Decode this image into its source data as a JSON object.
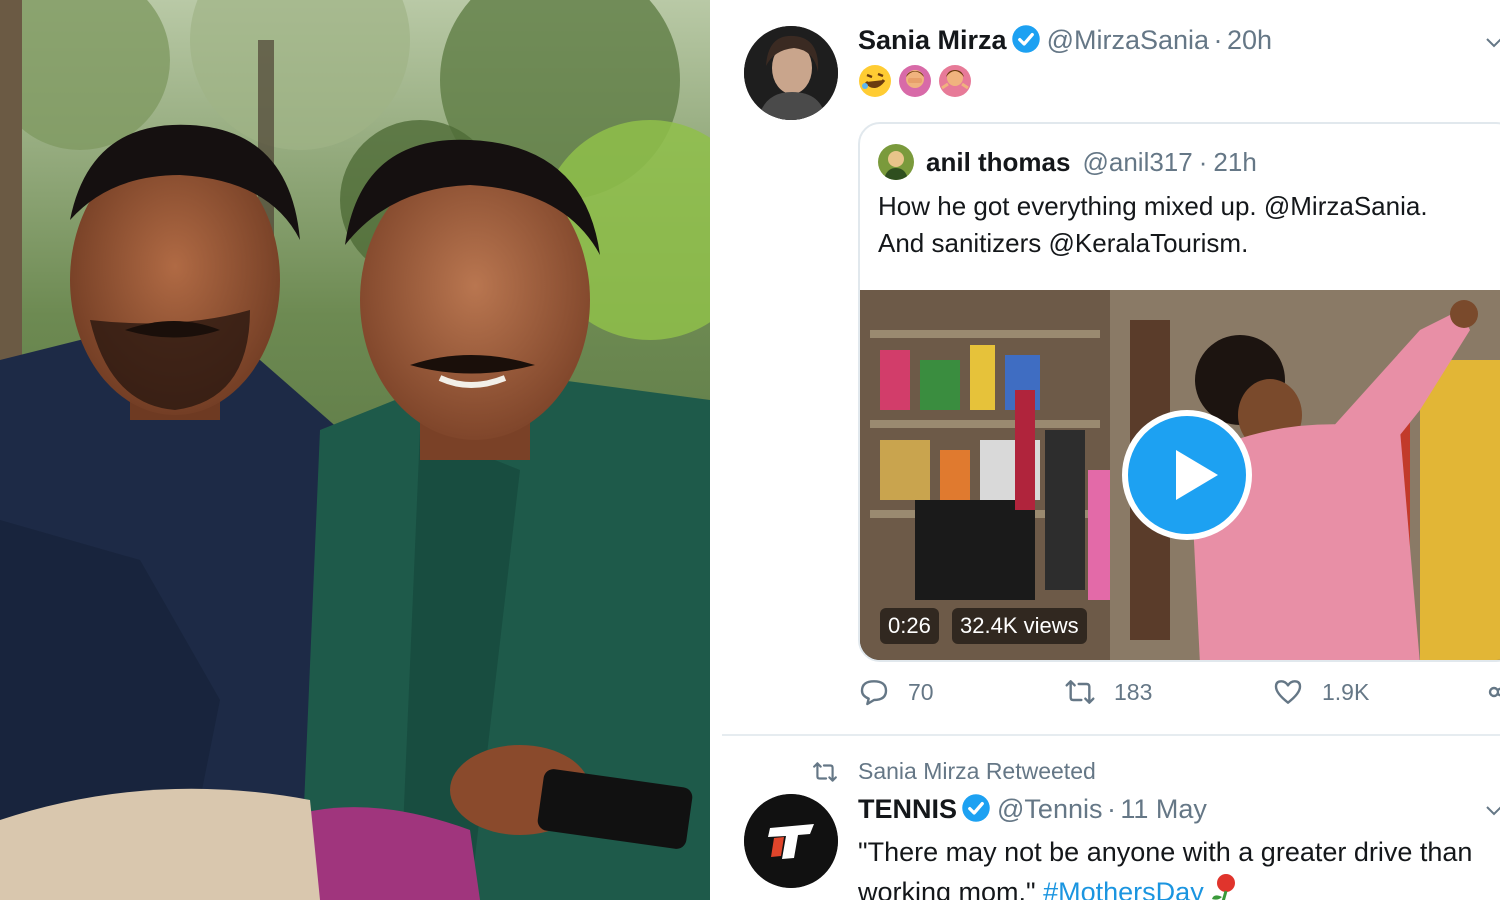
{
  "photo": {
    "description_icon": "two-men-photo"
  },
  "tweet1": {
    "name": "Sania Mirza",
    "handle": "@MirzaSania",
    "separator": "·",
    "time": "20h",
    "emoji_icons": [
      "rolling-laughing-emoji",
      "woman-facepalm-emoji",
      "woman-shrugging-emoji"
    ],
    "quote": {
      "name": "anil thomas",
      "handle": "@anil317",
      "separator": "·",
      "time": "21h",
      "text_line1": "How he got everything mixed up. @MirzaSania.",
      "text_line2": "And sanitizers @KeralaTourism.",
      "video": {
        "duration": "0:26",
        "views": "32.4K views"
      }
    },
    "actions": {
      "reply_count": "70",
      "retweet_count": "183",
      "like_count": "1.9K"
    }
  },
  "retweet_notice": "Sania Mirza Retweeted",
  "tweet2": {
    "name": "TENNIS",
    "handle": "@Tennis",
    "separator": "·",
    "time": "11 May",
    "text_line1": "\"There may not be anyone with a greater drive than",
    "text_line2_start": "working mom.\" ",
    "hashtag": "#MothersDay"
  },
  "colors": {
    "accent": "#1da1f2",
    "muted_text": "#657786",
    "link": "#1b95e0",
    "divider": "#e6ecf0"
  }
}
